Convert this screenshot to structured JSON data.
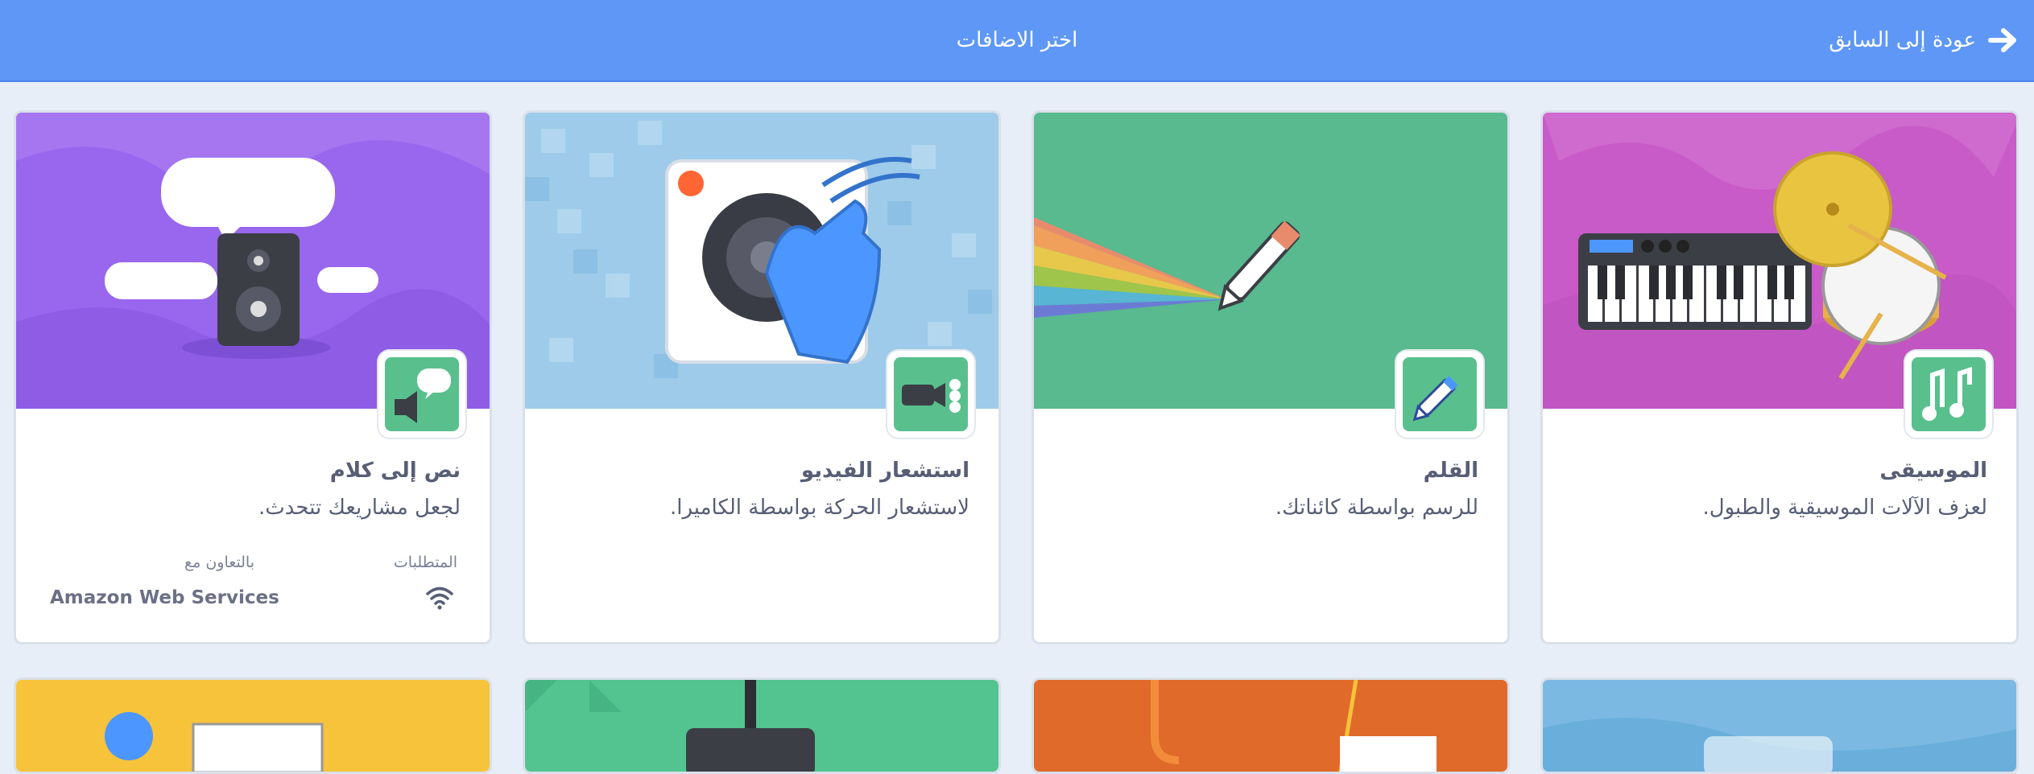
{
  "header": {
    "title": "اختر الاضافات",
    "back_label": "عودة إلى السابق"
  },
  "colors": {
    "header": "#5e97f6",
    "badge": "#59c08d",
    "text": "#575e75"
  },
  "extensions": [
    {
      "title": "الموسيقى",
      "description": "لعزف الآلات الموسيقية والطبول.",
      "image_icon": "music-keyboard-drum-illustration",
      "badge_icon": "music-note-icon",
      "background": "#c85bc8"
    },
    {
      "title": "القلم",
      "description": "للرسم بواسطة كائناتك.",
      "image_icon": "rainbow-pen-illustration",
      "badge_icon": "pen-icon",
      "background": "#59b98f"
    },
    {
      "title": "استشعار الفيديو",
      "description": "لاستشعار الحركة بواسطة الكاميرا.",
      "image_icon": "camera-hand-illustration",
      "badge_icon": "video-camera-icon",
      "background": "#9ecbea"
    },
    {
      "title": "نص إلى كلام",
      "description": "لجعل مشاريعك تتحدث.",
      "image_icon": "speaker-speech-bubbles-illustration",
      "badge_icon": "speech-bubble-icon",
      "background": "#9966ee",
      "requirements_label": "المتطلبات",
      "requirements_icon": "wifi-icon",
      "collaboration_label": "بالتعاون مع",
      "collaboration_value": "Amazon Web Services"
    }
  ]
}
